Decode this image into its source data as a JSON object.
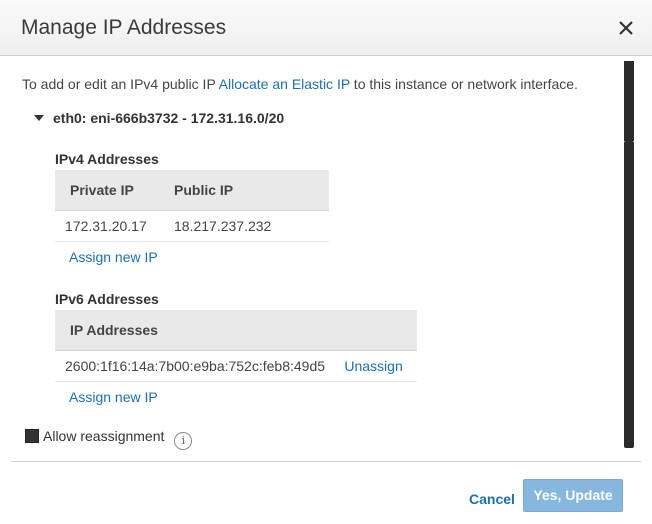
{
  "dialog": {
    "title": "Manage IP Addresses"
  },
  "intro": {
    "text_before": "To add or edit an IPv4 public IP ",
    "link": "Allocate an Elastic IP",
    "text_after": " to this instance or network interface."
  },
  "interface": {
    "label": "eth0: eni-666b3732 - 172.31.16.0/20"
  },
  "ipv4": {
    "section_label": "IPv4 Addresses",
    "columns": [
      "Private IP",
      "Public IP"
    ],
    "rows": [
      {
        "private_ip": "172.31.20.17",
        "public_ip": "18.217.237.232"
      }
    ],
    "assign_link": "Assign new IP"
  },
  "ipv6": {
    "section_label": "IPv6 Addresses",
    "columns": [
      "IP Addresses"
    ],
    "rows": [
      {
        "address": "2600:1f16:14a:7b00:e9ba:752c:feb8:49d5",
        "action": "Unassign"
      }
    ],
    "assign_link": "Assign new IP"
  },
  "reassignment": {
    "label": "Allow reassignment",
    "checked": true,
    "info_icon": "info-icon"
  },
  "footer": {
    "cancel_label": "Cancel",
    "update_label": "Yes, Update"
  },
  "colors": {
    "link": "#1a6fb5",
    "primary_button": "#86b7df",
    "table_header": "#e9e9e9"
  }
}
